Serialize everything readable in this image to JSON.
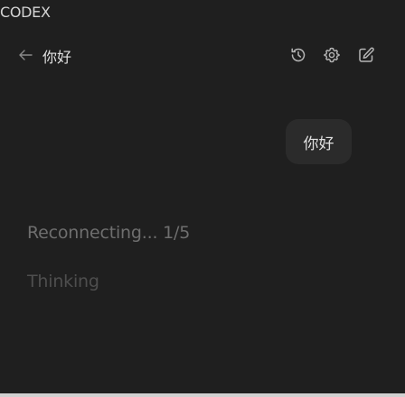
{
  "panel": {
    "title": "CODEX"
  },
  "header": {
    "back_icon": "arrow-left-icon",
    "title": "你好",
    "actions": [
      {
        "name": "history",
        "icon": "history-icon"
      },
      {
        "name": "settings",
        "icon": "gear-icon"
      },
      {
        "name": "new-chat",
        "icon": "compose-icon"
      }
    ]
  },
  "conversation": {
    "user_message": "你好",
    "status": "Reconnecting... 1/5",
    "thinking": "Thinking"
  },
  "colors": {
    "background": "#1f1f1f",
    "bubble": "#2b2b2b",
    "status_text": "#6e6e6e",
    "thinking_text": "#4e4e4e"
  }
}
